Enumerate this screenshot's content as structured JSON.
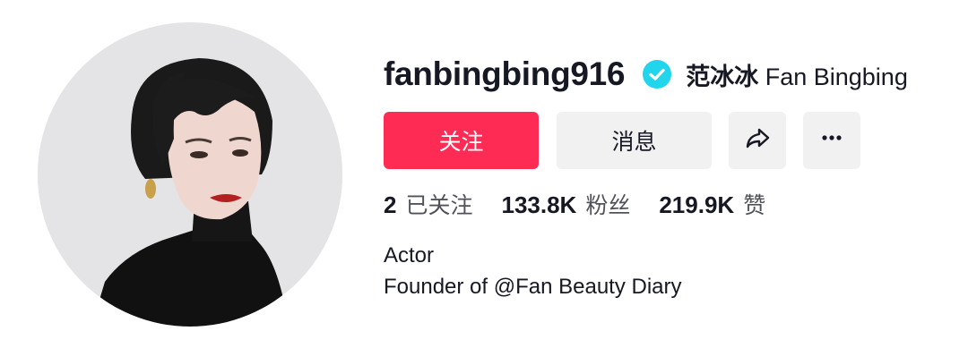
{
  "profile": {
    "username": "fanbingbing916",
    "nickname_cn": "范冰冰",
    "nickname_en": "Fan Bingbing",
    "verified": true
  },
  "buttons": {
    "follow_label": "关注",
    "message_label": "消息",
    "share_icon": "share-icon",
    "more_icon": "more-icon"
  },
  "stats": [
    {
      "value": "2",
      "label": "已关注"
    },
    {
      "value": "133.8K",
      "label": "粉丝"
    },
    {
      "value": "219.9K",
      "label": "赞"
    }
  ],
  "bio": {
    "line1": "Actor",
    "line2": "Founder of @Fan Beauty Diary"
  },
  "colors": {
    "accent": "#fe2c55",
    "verified": "#20d5ec",
    "button_bg": "#f1f1f2",
    "text": "#161823"
  }
}
